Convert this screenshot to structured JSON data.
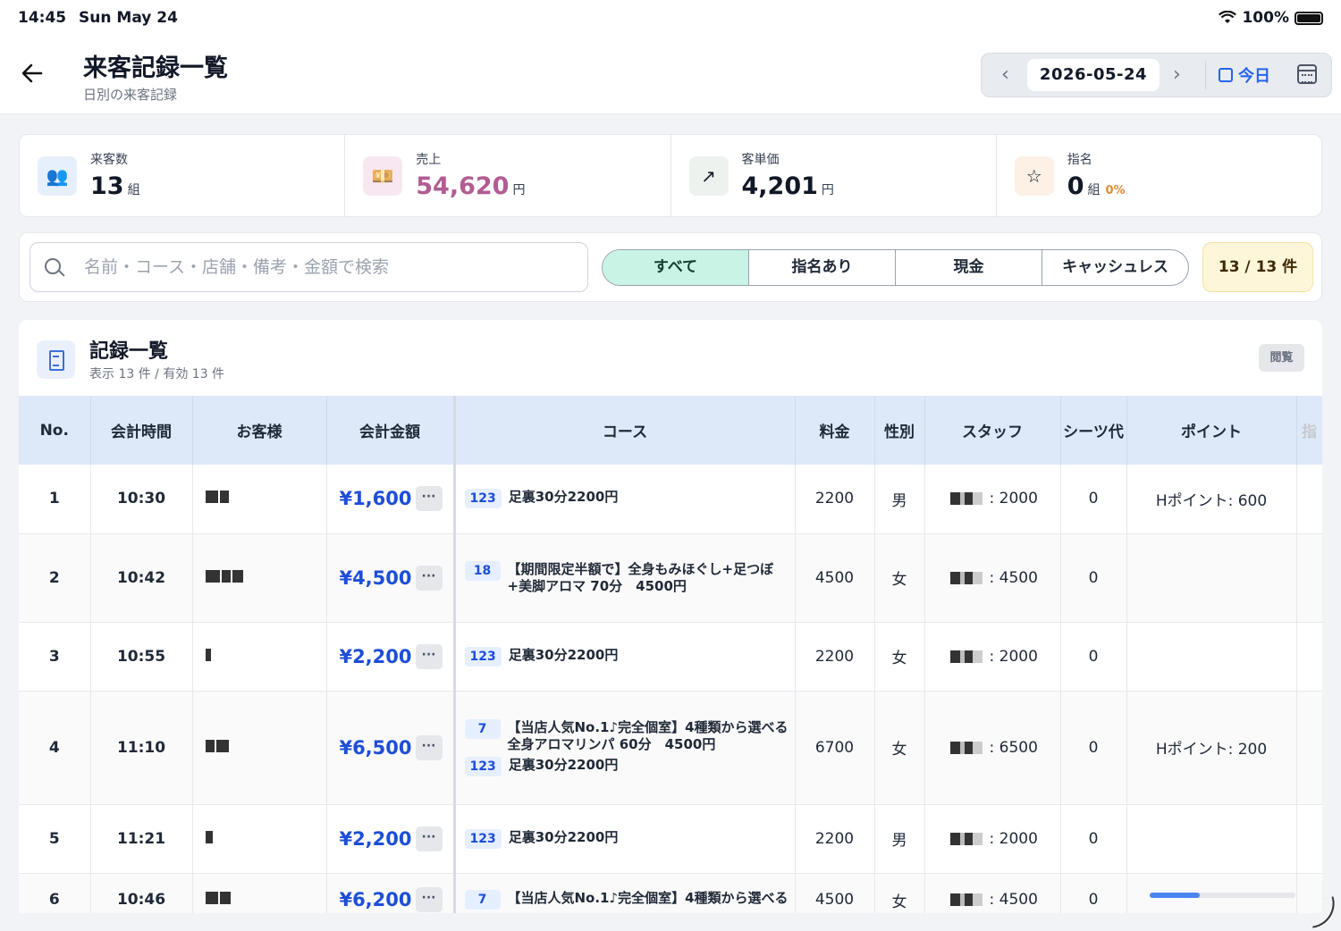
{
  "status_bar": {
    "time": "14:45",
    "date": "Sun May 24",
    "battery": "100%"
  },
  "header": {
    "title": "来客記録一覧",
    "subtitle": "日別の来客記録",
    "date": "2026-05-24",
    "today_label": "今日"
  },
  "stats": [
    {
      "label": "来客数",
      "value": "13",
      "unit": "組",
      "icon": "users-icon",
      "color": "#111827",
      "bg": "#e6effc"
    },
    {
      "label": "売上",
      "value": "54,620",
      "unit": "円",
      "icon": "banknote-icon",
      "color": "#b25c93",
      "bg": "#f8e7f1"
    },
    {
      "label": "客単価",
      "value": "4,201",
      "unit": "円",
      "icon": "trend-up-icon",
      "color": "#111827",
      "bg": "#edf2ee"
    },
    {
      "label": "指名",
      "value": "0",
      "unit": "組",
      "extra": "0%",
      "icon": "star-icon",
      "color": "#111827",
      "bg": "#fdf0e5"
    }
  ],
  "filters": {
    "search_placeholder": "名前・コース・店舗・備考・金額で検索",
    "segments": [
      "すべて",
      "指名あり",
      "現金",
      "キャッシュレス"
    ],
    "active_segment": 0,
    "count": "13 / 13 件"
  },
  "records": {
    "title": "記録一覧",
    "summary": "表示 13 件 / 有効 13 件",
    "view_button": "閲覧",
    "columns": [
      "No.",
      "会計時間",
      "お客様",
      "会計金額",
      "コース",
      "料金",
      "性別",
      "スタッフ",
      "シーツ代",
      "ポイント",
      "指"
    ],
    "rows": [
      {
        "no": "1",
        "time": "10:30",
        "amount": "¥1,600",
        "courses": [
          {
            "tag": "123",
            "name": "足裏30分2200円"
          }
        ],
        "fee": "2200",
        "gender": "男",
        "staff_amount": "2000",
        "sheet": "0",
        "points": "Hポイント: 600"
      },
      {
        "no": "2",
        "time": "10:42",
        "amount": "¥4,500",
        "courses": [
          {
            "tag": "18",
            "name": "【期間限定半額で】全身もみほぐし+足つぼ+美脚アロマ 70分　4500円"
          }
        ],
        "fee": "4500",
        "gender": "女",
        "staff_amount": "4500",
        "sheet": "0",
        "points": ""
      },
      {
        "no": "3",
        "time": "10:55",
        "amount": "¥2,200",
        "courses": [
          {
            "tag": "123",
            "name": "足裏30分2200円"
          }
        ],
        "fee": "2200",
        "gender": "女",
        "staff_amount": "2000",
        "sheet": "0",
        "points": ""
      },
      {
        "no": "4",
        "time": "11:10",
        "amount": "¥6,500",
        "courses": [
          {
            "tag": "7",
            "name": "【当店人気No.1♪完全個室】4種類から選べる全身アロマリンパ 60分　4500円"
          },
          {
            "tag": "123",
            "name": "足裏30分2200円"
          }
        ],
        "fee": "6700",
        "gender": "女",
        "staff_amount": "6500",
        "sheet": "0",
        "points": "Hポイント: 200"
      },
      {
        "no": "5",
        "time": "11:21",
        "amount": "¥2,200",
        "courses": [
          {
            "tag": "123",
            "name": "足裏30分2200円"
          }
        ],
        "fee": "2200",
        "gender": "男",
        "staff_amount": "2000",
        "sheet": "0",
        "points": ""
      },
      {
        "no": "6",
        "time": "10:46",
        "amount": "¥6,200",
        "courses": [
          {
            "tag": "7",
            "name": "【当店人気No.1♪完全個室】4種類から選べる"
          }
        ],
        "fee": "4500",
        "gender": "女",
        "staff_amount": "4500",
        "sheet": "0",
        "points": ""
      }
    ]
  },
  "colors": {
    "accent": "#2563eb",
    "segment_active": "#c9f3e4",
    "header_row": "#dde9f8",
    "badge": "#fef6d8"
  }
}
